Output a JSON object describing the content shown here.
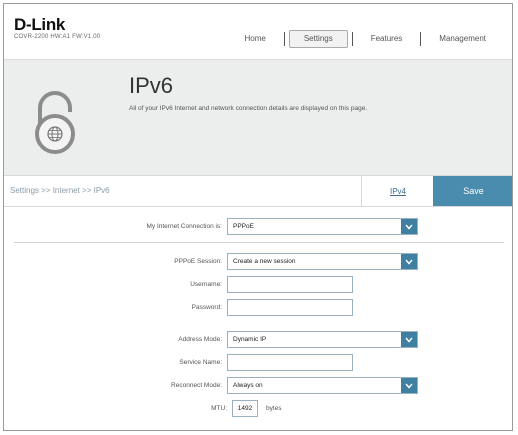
{
  "brand": {
    "logo": "D-Link",
    "model": "COVR-2200 HW:A1 FW:V1.00"
  },
  "nav": {
    "items": [
      {
        "label": "Home"
      },
      {
        "label": "Settings"
      },
      {
        "label": "Features"
      },
      {
        "label": "Management"
      }
    ],
    "active": "Settings"
  },
  "banner": {
    "title": "IPv6",
    "description": "All of your IPv6 Internet and network connection details are displayed on this page."
  },
  "toolbar": {
    "breadcrumb": "Settings >> Internet >> IPv6",
    "ipv4_label": "IPv4",
    "save_label": "Save"
  },
  "form": {
    "connection": {
      "label": "My Internet Connection is:",
      "value": "PPPoE"
    },
    "session": {
      "label": "PPPoE Session:",
      "value": "Create a new session"
    },
    "username": {
      "label": "Username:",
      "value": ""
    },
    "password": {
      "label": "Password:",
      "value": ""
    },
    "address_mode": {
      "label": "Address Mode:",
      "value": "Dynamic IP"
    },
    "service_name": {
      "label": "Service Name:",
      "value": ""
    },
    "reconnect_mode": {
      "label": "Reconnect Mode:",
      "value": "Always on"
    },
    "mtu": {
      "label": "MTU:",
      "value": "1492",
      "unit": "bytes"
    }
  },
  "colors": {
    "accent": "#4a8cad",
    "select_arrow": "#3e7fa2",
    "banner_bg": "#eceeee"
  }
}
